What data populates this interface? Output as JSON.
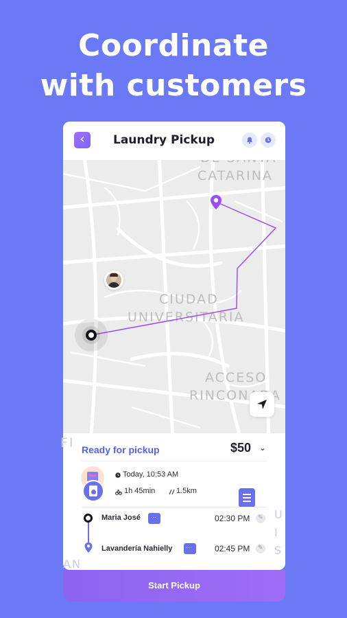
{
  "headline": {
    "line1": "Coordinate",
    "line2": "with customers"
  },
  "header": {
    "title": "Laundry Pickup",
    "back_icon": "chevron-left-icon",
    "notification_icon": "bell-icon",
    "clock_icon": "clock-icon"
  },
  "map": {
    "labels": [
      "DE SANTA",
      "CATARINA",
      "CIUDAD",
      "UNIVERSITARIA",
      "ACCESO",
      "RINCONADA",
      "FI",
      "AN",
      "U",
      "I",
      "S"
    ],
    "locate_icon": "navigation-arrow-icon"
  },
  "order": {
    "status": "Ready for pickup",
    "price": "$50",
    "date": "Today, 10:53 AM",
    "duration": "1h 45min",
    "distance": "1.5km"
  },
  "stops": [
    {
      "name": "Maria José",
      "time": "02:30 PM"
    },
    {
      "name": "Lavandería Nahielly",
      "time": "02:45 PM"
    }
  ],
  "action": {
    "start_label": "Start Pickup"
  },
  "colors": {
    "background": "#6c79f6",
    "accent": "#7f64f3",
    "route": "#9b4dfa",
    "status": "#5661e8"
  }
}
